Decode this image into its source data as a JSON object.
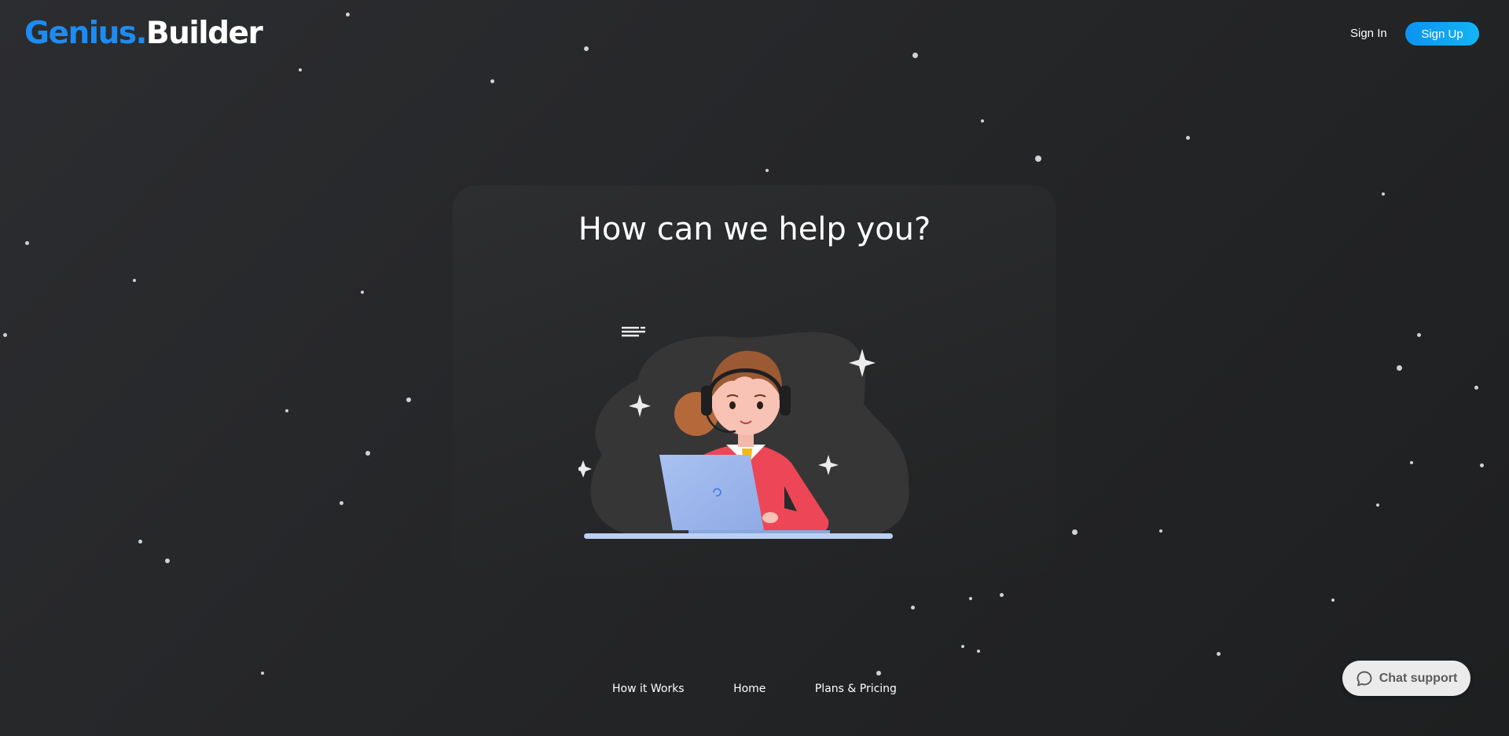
{
  "header": {
    "logo_part1": "Genius.",
    "logo_part2": "Builder",
    "signin_label": "Sign In",
    "signup_label": "Sign Up"
  },
  "hero": {
    "headline": "How can we help you?",
    "illustration": "support-agent-illustration"
  },
  "footer": {
    "links": [
      {
        "label": "How it Works"
      },
      {
        "label": "Home"
      },
      {
        "label": "Plans & Pricing"
      }
    ]
  },
  "chat": {
    "label": "Chat support",
    "icon": "chat-bubble-icon"
  },
  "colors": {
    "brand_blue": "#1c8cf2",
    "signup_gradient_start": "#0a93f2",
    "signup_gradient_end": "#14b4f5",
    "background": "#252628"
  }
}
